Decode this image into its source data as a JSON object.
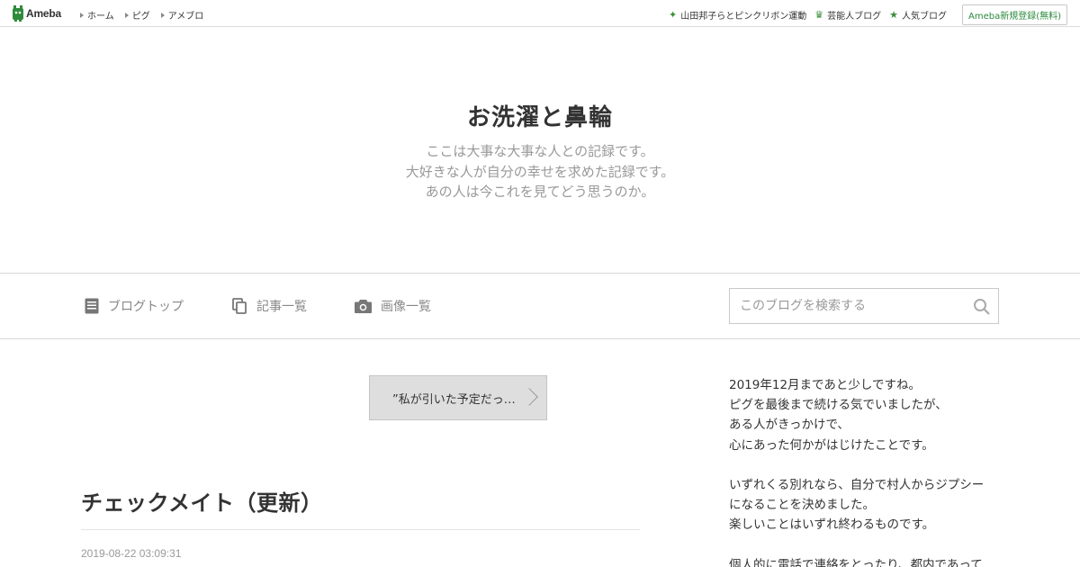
{
  "topbar": {
    "logo": "Ameba",
    "nav": [
      "ホーム",
      "ピグ",
      "アメブロ"
    ],
    "right_links": [
      {
        "icon": "sparkle-icon",
        "label": "山田邦子らとピンクリボン運動"
      },
      {
        "icon": "crown-icon",
        "label": "芸能人ブログ"
      },
      {
        "icon": "star-icon",
        "label": "人気ブログ"
      }
    ],
    "register": "Ameba新規登録(無料)"
  },
  "header": {
    "title": "お洗濯と鼻輪",
    "description": [
      "ここは大事な大事な人との記録です。",
      "大好きな人が自分の幸せを求めた記録です。",
      "あの人は今これを見てどう思うのか。"
    ]
  },
  "nav": {
    "blog_top": "ブログトップ",
    "entries": "記事一覧",
    "images": "画像一覧",
    "search_placeholder": "このブログを検索する"
  },
  "main": {
    "prev_link": "”私が引いた予定だっ…",
    "entry_title": "チェックメイト（更新）",
    "entry_date": "2019-08-22 03:09:31"
  },
  "sidebar": {
    "paragraphs": [
      [
        "2019年12月まであと少しですね。",
        "ピグを最後まで続ける気でいましたが、",
        "ある人がきっかけで、",
        "心にあった何かがはじけたことです。"
      ],
      [
        "いずれくる別れなら、自分で村人からジプシー",
        "になることを決めました。",
        "楽しいことはいずれ終わるものです。"
      ],
      [
        "個人的に電話で連絡をとったり、都内であって"
      ]
    ]
  },
  "colors": {
    "accent_green": "#2b8a3e",
    "muted_text": "#999999"
  }
}
